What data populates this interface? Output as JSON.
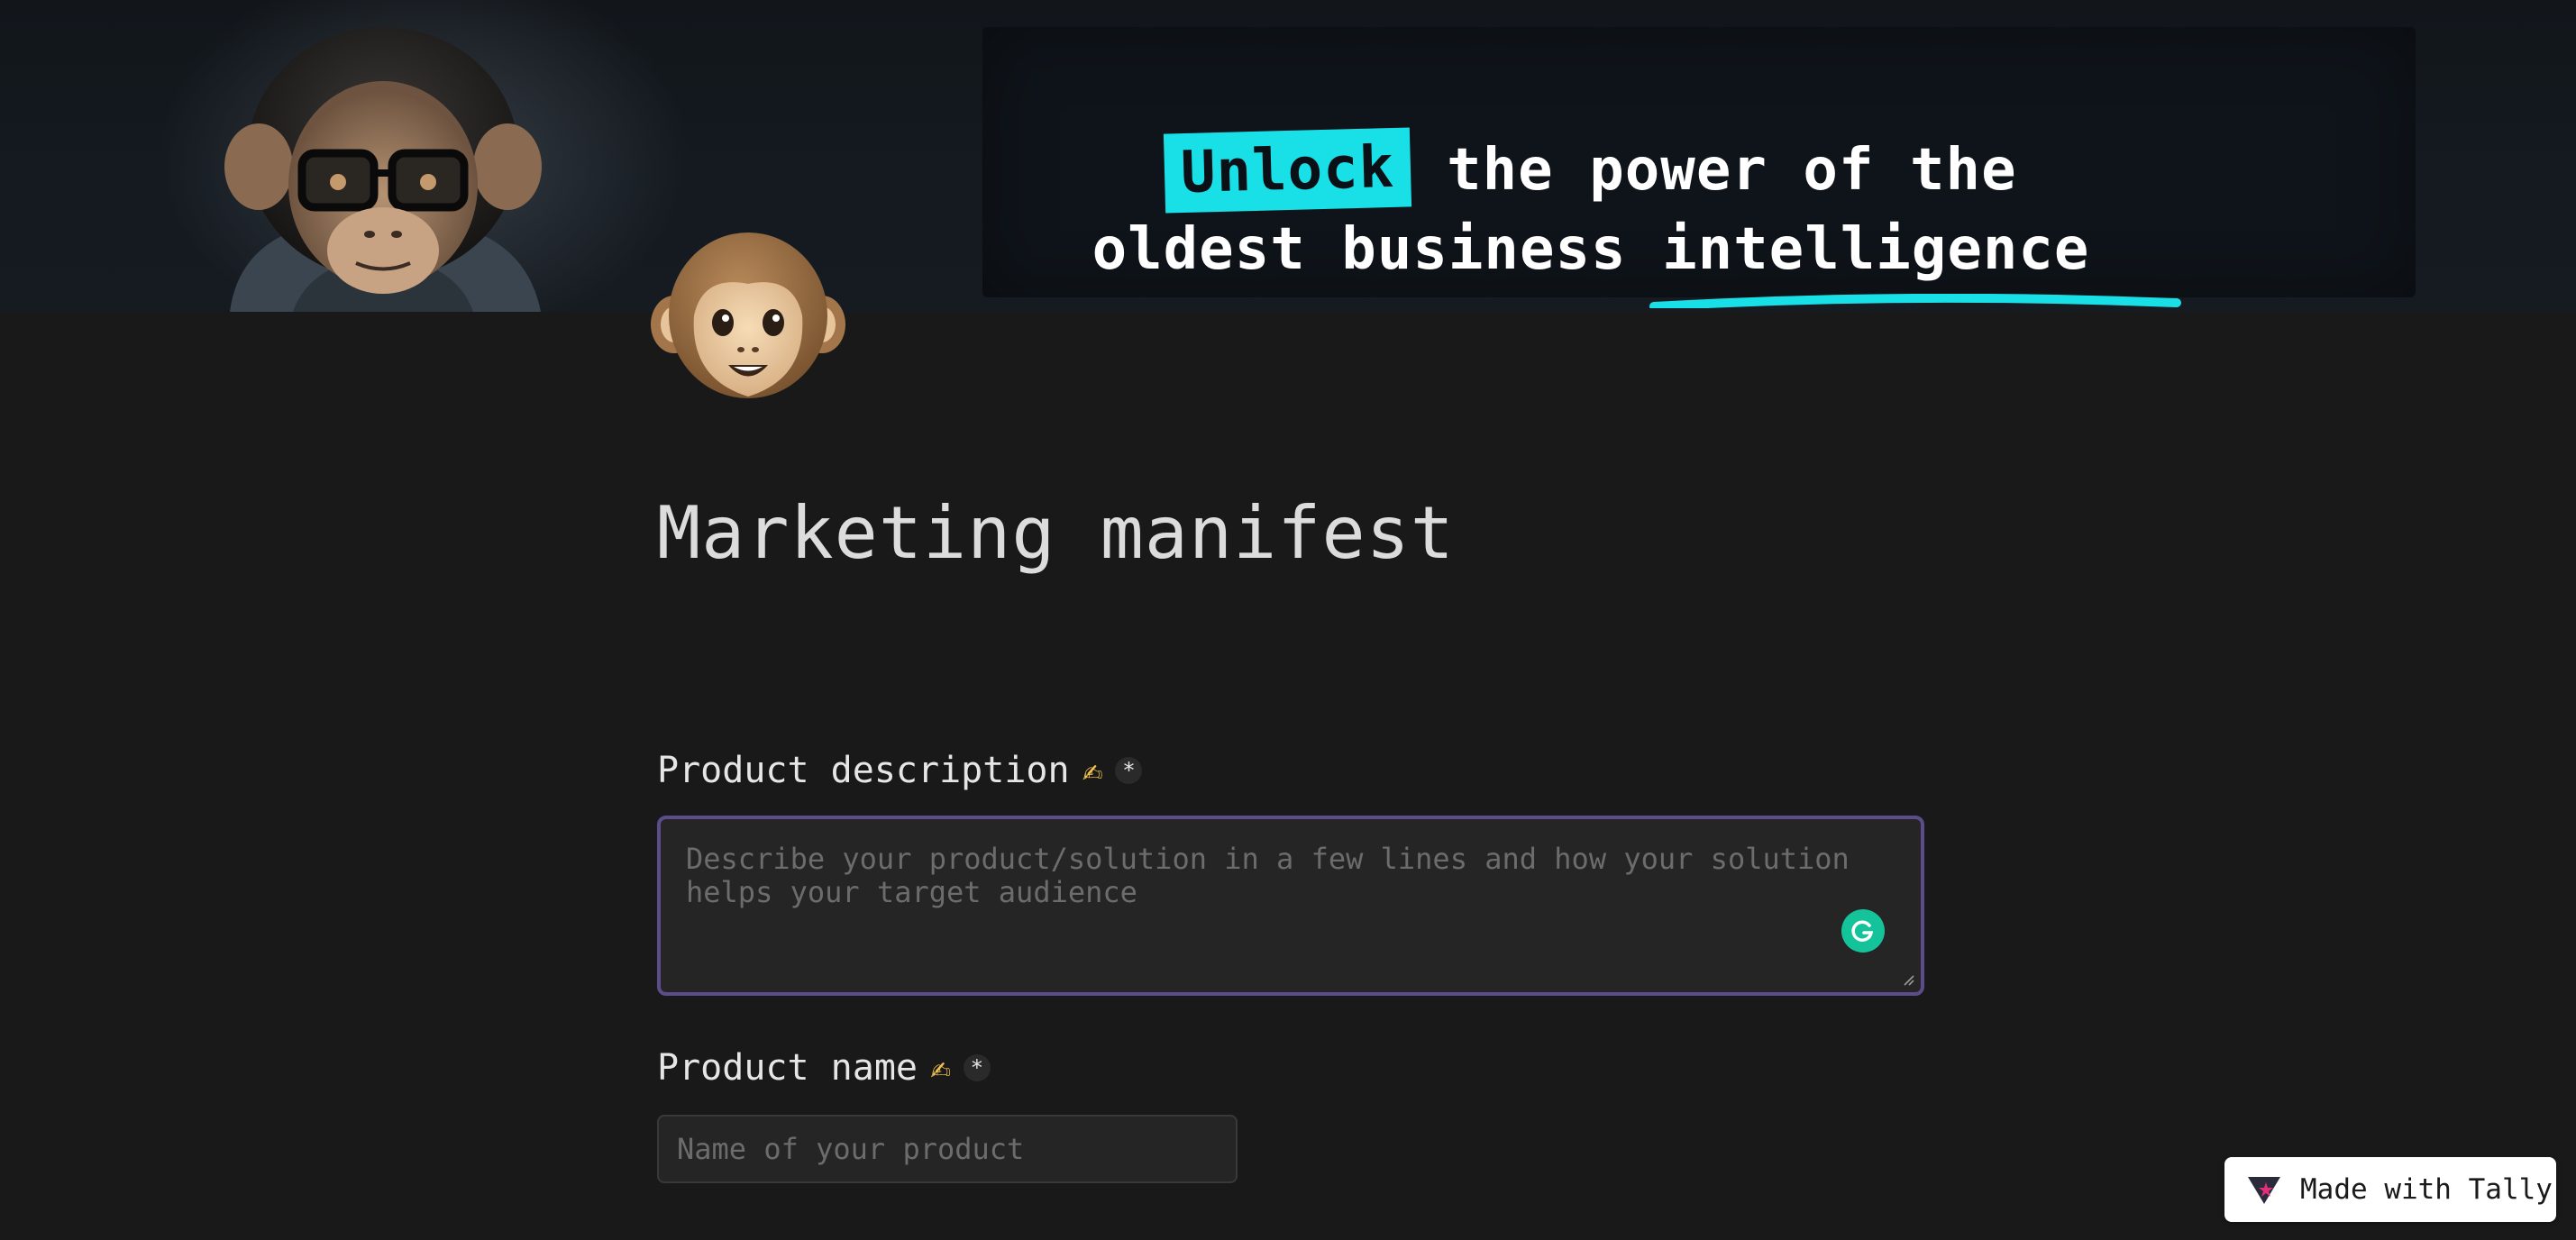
{
  "banner": {
    "headline_highlight": "Unlock",
    "headline_line1_rest": " the power of the",
    "headline_line2": "oldest business intelligence",
    "highlight_color": "#19e0e6",
    "avatar_emoji": "🐵"
  },
  "form": {
    "title": "Marketing manifest",
    "questions": [
      {
        "label": "Product description",
        "emoji": "✍",
        "required_marker": "*",
        "placeholder": "Describe your product/solution in a few lines and how your solution helps your target audience",
        "value": ""
      },
      {
        "label": "Product name",
        "emoji": "✍",
        "required_marker": "*",
        "placeholder": "Name of your product",
        "value": ""
      }
    ],
    "focus_border_color": "#5b4c8c"
  },
  "badge": {
    "label": "Made with Tally"
  },
  "icons": {
    "grammarly": "grammarly-icon",
    "tally_logo": "tally-logo-icon"
  }
}
